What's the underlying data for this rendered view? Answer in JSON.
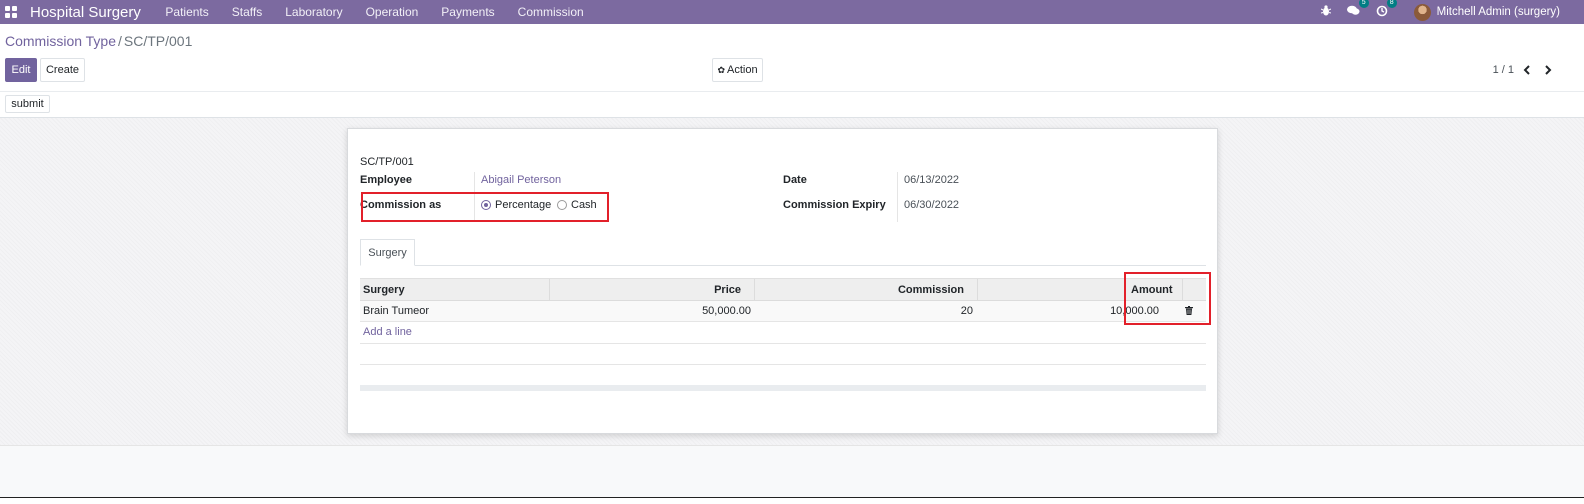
{
  "navbar": {
    "brand": "Hospital Surgery",
    "menu": [
      "Patients",
      "Staffs",
      "Laboratory",
      "Operation",
      "Payments",
      "Commission"
    ],
    "messages_badge": "5",
    "activity_badge": "8",
    "user": "Mitchell Admin (surgery)"
  },
  "breadcrumb": {
    "parent": "Commission Type",
    "separator": "/",
    "current": "SC/TP/001"
  },
  "buttons": {
    "edit": "Edit",
    "create": "Create",
    "action": "Action",
    "submit": "submit"
  },
  "pager": {
    "value": "1 / 1",
    "prev": "‹",
    "next": "›"
  },
  "form": {
    "reference": "SC/TP/001",
    "employee_label": "Employee",
    "employee_value": "Abigail Peterson",
    "commission_as_label": "Commission as",
    "options": [
      "Percentage",
      "Cash"
    ],
    "selected_option": "Percentage",
    "date_label": "Date",
    "date_value": "06/13/2022",
    "expiry_label": "Commission Expiry",
    "expiry_value": "06/30/2022"
  },
  "tab": {
    "label": "Surgery"
  },
  "table": {
    "columns": [
      "Surgery",
      "Price",
      "Commission",
      "Amount"
    ],
    "rows": [
      {
        "surgery": "Brain Tumeor",
        "price": "50,000.00",
        "commission": "20",
        "amount": "10,000.00"
      }
    ],
    "add_line": "Add a line"
  }
}
